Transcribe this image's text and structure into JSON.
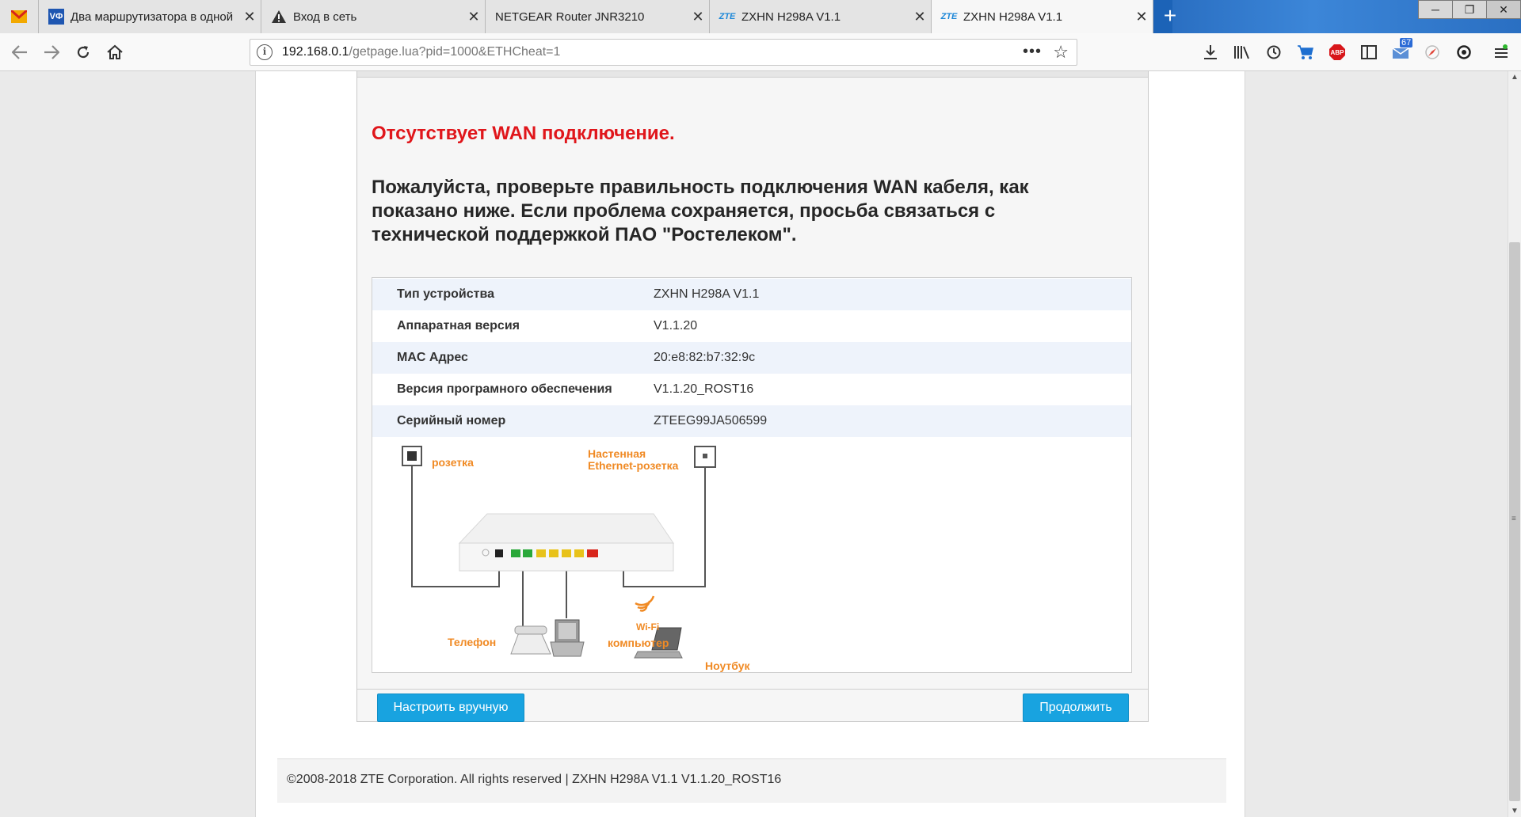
{
  "browser": {
    "tabs": [
      {
        "label": "",
        "favicon": "mail-icon"
      },
      {
        "label": "Два маршрутизатора в одной",
        "favicon": "VФ"
      },
      {
        "label": "Вход в сеть",
        "favicon": "warning-icon"
      },
      {
        "label": "NETGEAR Router JNR3210",
        "favicon": ""
      },
      {
        "label": "ZXHN H298A V1.1",
        "favicon": "ZTE"
      },
      {
        "label": "ZXHN H298A V1.1",
        "favicon": "ZTE",
        "active": true
      }
    ],
    "address": {
      "host": "192.168.0.1",
      "path": "/getpage.lua?pid=1000&ETHCheat=1"
    },
    "badge_count": "67",
    "abp_label": "ABP"
  },
  "page": {
    "warning_title": "Отсутствует WAN подключение.",
    "warning_message": "Пожалуйста, проверьте правильность подключения WAN кабеля, как показано ниже. Если проблема сохраняется, просьба связаться с технической поддержкой ПАО \"Ростелеком\".",
    "device_info": [
      {
        "label": "Тип устройства",
        "value": "ZXHN H298A V1.1"
      },
      {
        "label": "Аппаратная версия",
        "value": "V1.1.20"
      },
      {
        "label": "MAC Адрес",
        "value": "20:e8:82:b7:32:9c"
      },
      {
        "label": "Версия програмного обеспечения",
        "value": "V1.1.20_ROST16"
      },
      {
        "label": "Серийный номер",
        "value": "ZTEEG99JA506599"
      }
    ],
    "diagram": {
      "socket": "розетка",
      "wall_ethernet": "Настенная\nEthernet-розетка",
      "phone": "Телефон",
      "computer": "компьютер",
      "wifi": "Wi-Fi",
      "laptop": "Ноутбук"
    },
    "buttons": {
      "manual": "Настроить вручную",
      "continue": "Продолжить"
    },
    "footer": "©2008-2018 ZTE Corporation. All rights reserved  |   ZXHN H298A V1.1 V1.1.20_ROST16"
  },
  "colors": {
    "warning": "#e0161b",
    "button": "#18a3e0",
    "diagram_label": "#f08a24",
    "tab_bar": "#1c63b7"
  }
}
